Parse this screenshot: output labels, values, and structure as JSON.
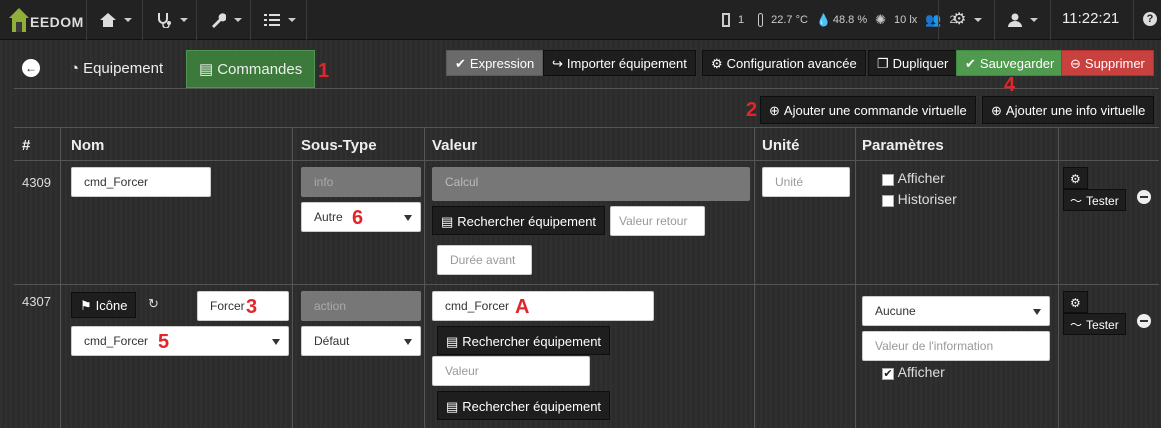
{
  "navbar": {
    "logo_text": "EEDOM",
    "menus": [
      {
        "icon": "home-icon"
      },
      {
        "icon": "stethoscope-icon"
      },
      {
        "icon": "wrench-icon"
      },
      {
        "icon": "tasks-icon"
      }
    ],
    "status": {
      "door": "1",
      "temperature": "22.7 °C",
      "humidity": "48.8 %",
      "luminosity": "10 lx",
      "presence": "2"
    },
    "time": "11:22:21"
  },
  "tabs": {
    "equipement": "Equipement",
    "commandes": "Commandes"
  },
  "toolbar": {
    "expression": "Expression",
    "importer": "Importer équipement",
    "config": "Configuration avancée",
    "dupliquer": "Dupliquer",
    "sauvegarder": "Sauvegarder",
    "supprimer": "Supprimer",
    "add_cmd": "Ajouter une commande virtuelle",
    "add_info": "Ajouter une info virtuelle"
  },
  "annotations": {
    "n1": "1",
    "n2": "2",
    "n3": "3",
    "n4": "4",
    "n5": "5",
    "n6": "6",
    "nA": "A"
  },
  "table": {
    "headers": {
      "id": "#",
      "nom": "Nom",
      "soustype": "Sous-Type",
      "valeur": "Valeur",
      "unite": "Unité",
      "parametres": "Paramètres"
    },
    "row1": {
      "id": "4309",
      "nom": "cmd_Forcer",
      "type": "info",
      "soustype": "Autre",
      "calcul_placeholder": "Calcul",
      "rechercher": "Rechercher équipement",
      "valeur_retour_placeholder": "Valeur retour",
      "duree_avant_placeholder": "Durée avant",
      "unite_placeholder": "Unité",
      "afficher": "Afficher",
      "historiser": "Historiser",
      "tester": "Tester"
    },
    "row2": {
      "id": "4307",
      "icone": "Icône",
      "nom": "Forcer",
      "type": "action",
      "soustype": "Défaut",
      "linked_cmd": "cmd_Forcer",
      "valeur_input": "cmd_Forcer",
      "rechercher1": "Rechercher équipement",
      "valeur_placeholder": "Valeur",
      "rechercher2": "Rechercher équipement",
      "aucune": "Aucune",
      "valeur_info_placeholder": "Valeur de l'information",
      "afficher": "Afficher",
      "tester": "Tester"
    }
  }
}
